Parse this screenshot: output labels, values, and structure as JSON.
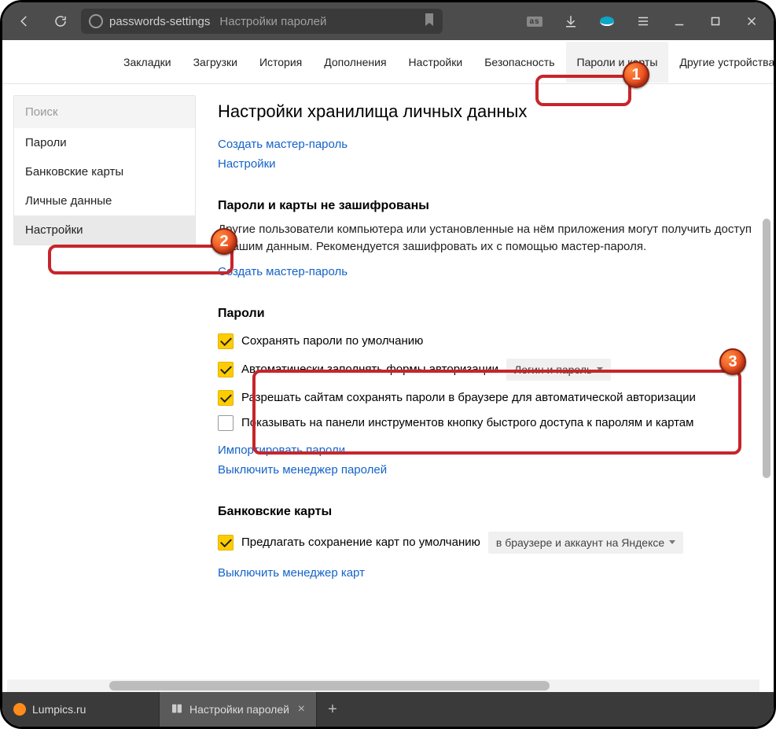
{
  "chrome": {
    "url_segment1": "passwords-settings",
    "url_segment2": "Настройки паролей"
  },
  "topnav": {
    "items": [
      "Закладки",
      "Загрузки",
      "История",
      "Дополнения",
      "Настройки",
      "Безопасность",
      "Пароли и карты",
      "Другие устройства"
    ]
  },
  "sidebar": {
    "search_placeholder": "Поиск",
    "items": [
      "Пароли",
      "Банковские карты",
      "Личные данные",
      "Настройки"
    ]
  },
  "main": {
    "heading": "Настройки хранилища личных данных",
    "link_create_master": "Создать мастер-пароль",
    "link_settings": "Настройки",
    "sec_unencrypted_title": "Пароли и карты не зашифрованы",
    "sec_unencrypted_desc": "Другие пользователи компьютера или установленные на нём приложения могут получить доступ к вашим данным. Рекомендуется зашифровать их с помощью мастер-пароля.",
    "link_create_master2": "Создать мастер-пароль",
    "sec_passwords_title": "Пароли",
    "opts": {
      "save_default": "Сохранять пароли по умолчанию",
      "autofill": "Автоматически заполнять формы авторизации",
      "autofill_dd": "Логин и пароль",
      "allow_sites": "Разрешать сайтам сохранять пароли в браузере для автоматической авторизации",
      "show_toolbar": "Показывать на панели инструментов кнопку быстрого доступа к паролям и картам"
    },
    "link_import": "Импортировать пароли",
    "link_disable_pw": "Выключить менеджер паролей",
    "sec_cards_title": "Банковские карты",
    "card_opt": "Предлагать сохранение карт по умолчанию",
    "card_dd": "в браузере и аккаунт на Яндексе",
    "link_disable_cards": "Выключить менеджер карт"
  },
  "tabs": {
    "tab1": "Lumpics.ru",
    "tab2": "Настройки паролей"
  },
  "badges": {
    "b1": "1",
    "b2": "2",
    "b3": "3"
  }
}
